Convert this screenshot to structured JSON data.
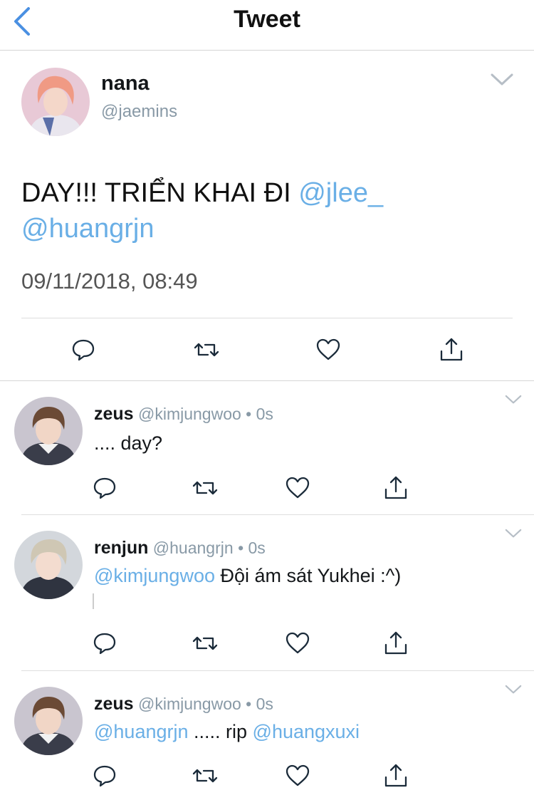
{
  "header": {
    "title": "Tweet"
  },
  "main_tweet": {
    "name": "nana",
    "handle": "@jaemins",
    "text": "DAY!!! TRIỂN KHAI ĐI ",
    "mentions": [
      "@jlee_",
      "@huangrjn"
    ],
    "date": "09/11/2018, 08:49"
  },
  "replies": [
    {
      "name": "zeus",
      "handle": "@kimjungwoo",
      "time": "• 0s",
      "mention": "",
      "text": ".... day?",
      "mention2": ""
    },
    {
      "name": "renjun",
      "handle": "@huangrjn",
      "time": "• 0s",
      "mention": "@kimjungwoo",
      "text": " Đội ám sát Yukhei :^)",
      "mention2": ""
    },
    {
      "name": "zeus",
      "handle": "@kimjungwoo",
      "time": "• 0s",
      "mention": "@huangrjn",
      "text": " ..... rip ",
      "mention2": "@huangxuxi"
    }
  ],
  "colors": {
    "accent": "#6aafe6",
    "back": "#4a90e2",
    "icon": "#1b2b3a",
    "muted": "#8899a6"
  },
  "icons": [
    "back-chevron-icon",
    "chevron-down-icon",
    "reply-icon",
    "retweet-icon",
    "like-icon",
    "share-icon"
  ]
}
